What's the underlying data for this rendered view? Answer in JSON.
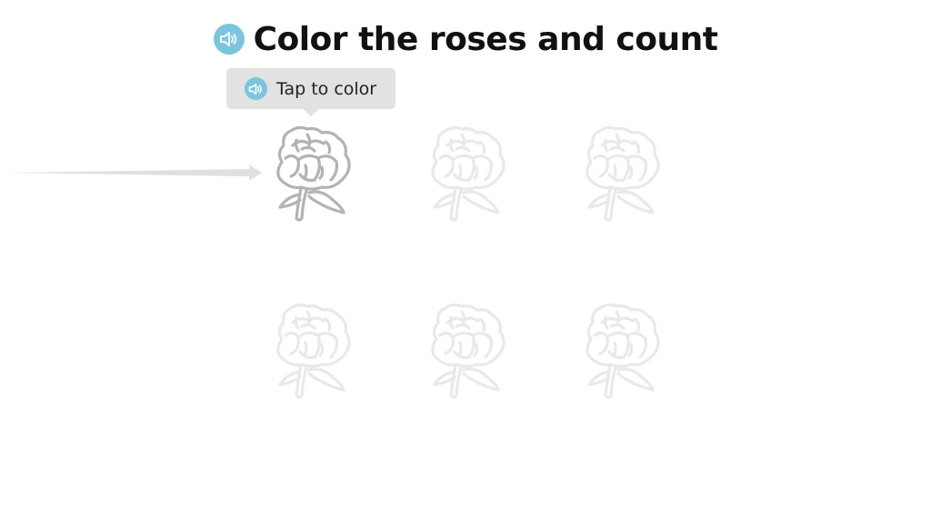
{
  "header": {
    "title": "Color the roses and count",
    "speaker_icon": "speaker-icon"
  },
  "hint": {
    "label": "Tap to color",
    "speaker_icon": "speaker-icon"
  },
  "colors": {
    "speaker_bg": "#7cc4de",
    "hint_bg": "#e2e2e2",
    "active_outline": "#b3b3b3",
    "faded_outline": "#e9e9e9",
    "arrow": "#e0e0e0"
  },
  "roses": [
    {
      "id": 1,
      "state": "active"
    },
    {
      "id": 2,
      "state": "faded"
    },
    {
      "id": 3,
      "state": "faded"
    },
    {
      "id": 4,
      "state": "faded"
    },
    {
      "id": 5,
      "state": "faded"
    },
    {
      "id": 6,
      "state": "faded"
    }
  ]
}
